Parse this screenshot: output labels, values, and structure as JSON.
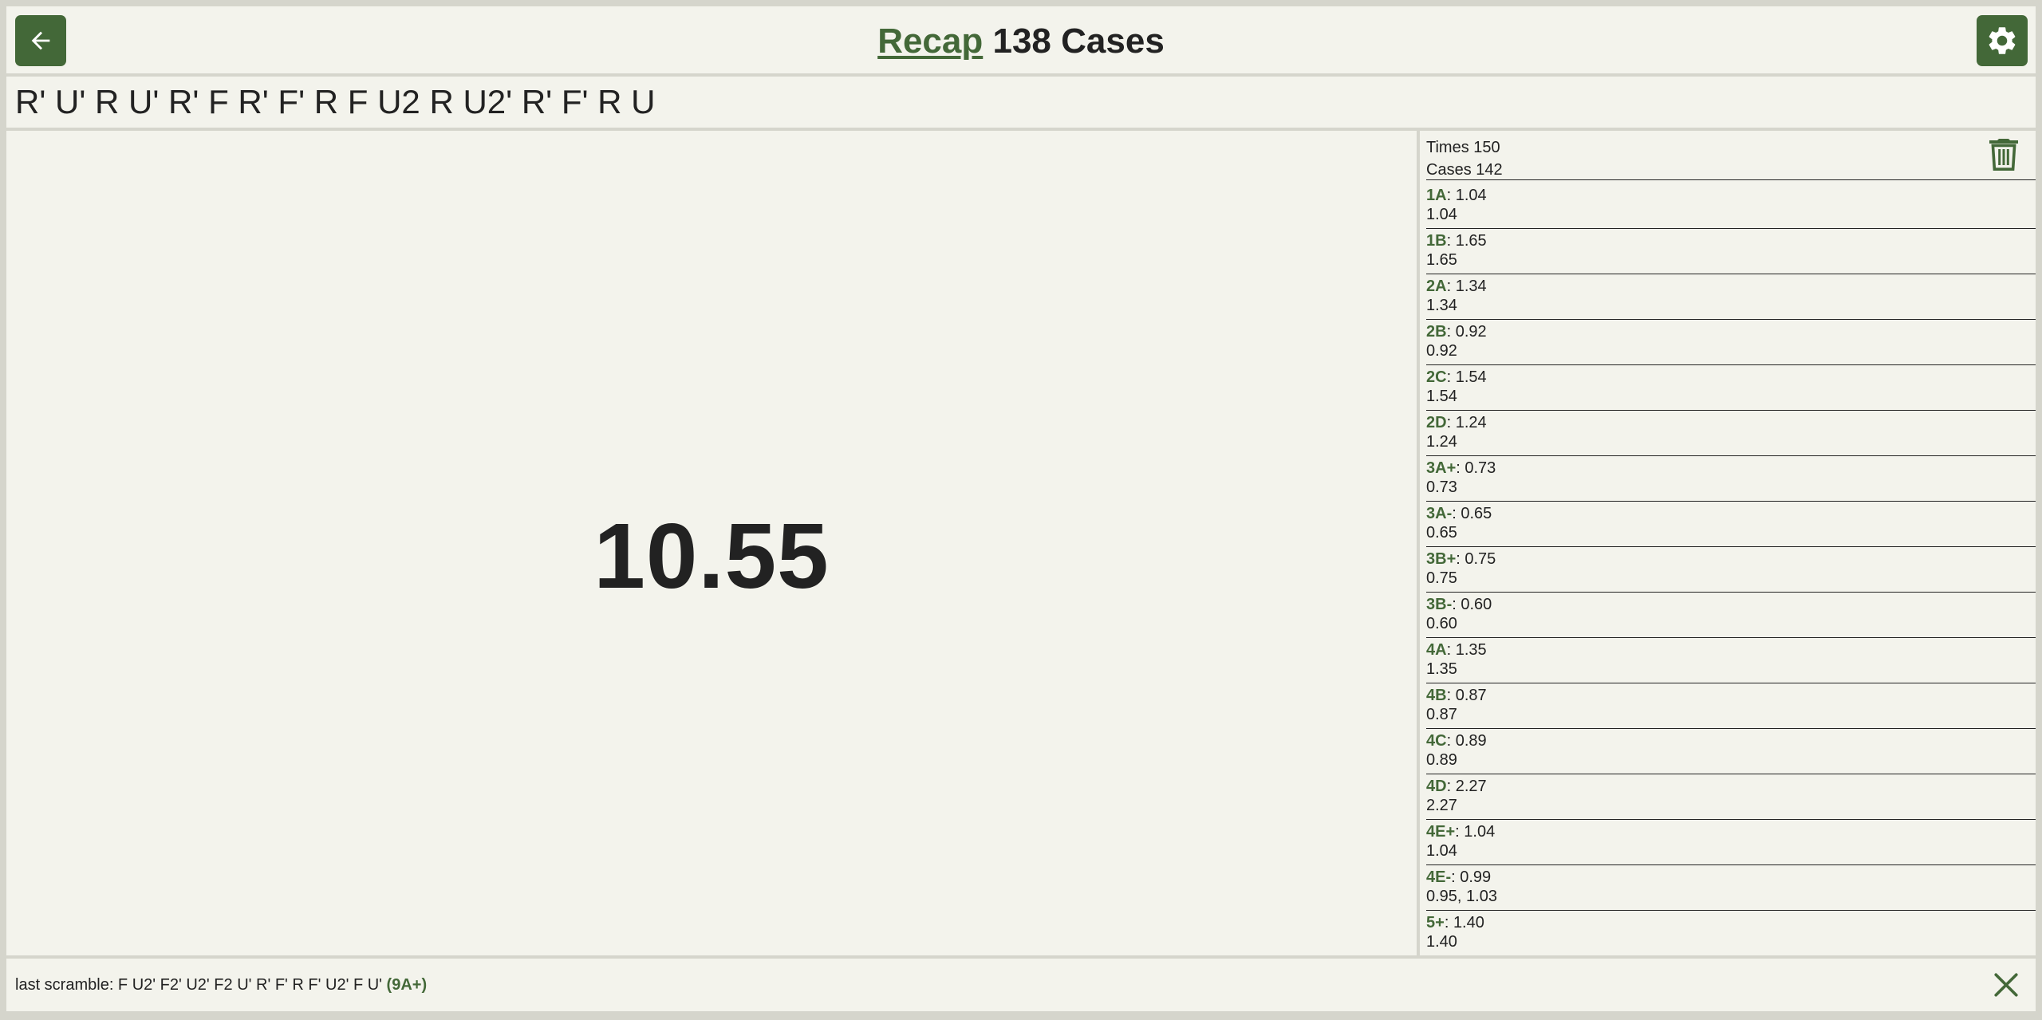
{
  "header": {
    "title_link": "Recap",
    "title_rest": " 138 Cases"
  },
  "scramble": "R' U' R U' R' F R' F' R F U2 R U2' R' F' R U",
  "timer": {
    "value": "10.55"
  },
  "stats": {
    "times_label": "Times 150",
    "cases_label": "Cases 142",
    "cases": [
      {
        "name": "1A",
        "best": "1.04",
        "times": "1.04"
      },
      {
        "name": "1B",
        "best": "1.65",
        "times": "1.65"
      },
      {
        "name": "2A",
        "best": "1.34",
        "times": "1.34"
      },
      {
        "name": "2B",
        "best": "0.92",
        "times": "0.92"
      },
      {
        "name": "2C",
        "best": "1.54",
        "times": "1.54"
      },
      {
        "name": "2D",
        "best": "1.24",
        "times": "1.24"
      },
      {
        "name": "3A+",
        "best": "0.73",
        "times": "0.73"
      },
      {
        "name": "3A-",
        "best": "0.65",
        "times": "0.65"
      },
      {
        "name": "3B+",
        "best": "0.75",
        "times": "0.75"
      },
      {
        "name": "3B-",
        "best": "0.60",
        "times": "0.60"
      },
      {
        "name": "4A",
        "best": "1.35",
        "times": "1.35"
      },
      {
        "name": "4B",
        "best": "0.87",
        "times": "0.87"
      },
      {
        "name": "4C",
        "best": "0.89",
        "times": "0.89"
      },
      {
        "name": "4D",
        "best": "2.27",
        "times": "2.27"
      },
      {
        "name": "4E+",
        "best": "1.04",
        "times": "1.04"
      },
      {
        "name": "4E-",
        "best": "0.99",
        "times": "0.95, 1.03"
      },
      {
        "name": "5+",
        "best": "1.40",
        "times": "1.40"
      }
    ]
  },
  "footer": {
    "label": "last scramble: F U2' F2' U2' F2 U' R' F' R F' U2' F U' ",
    "case": "(9A+)"
  },
  "icons": {
    "back": "arrow-left-icon",
    "settings": "gear-icon",
    "delete": "trash-icon",
    "close": "close-icon"
  },
  "colors": {
    "accent": "#436838",
    "panel": "#f3f3ec",
    "background": "#d5d5cc",
    "text": "#222222"
  }
}
